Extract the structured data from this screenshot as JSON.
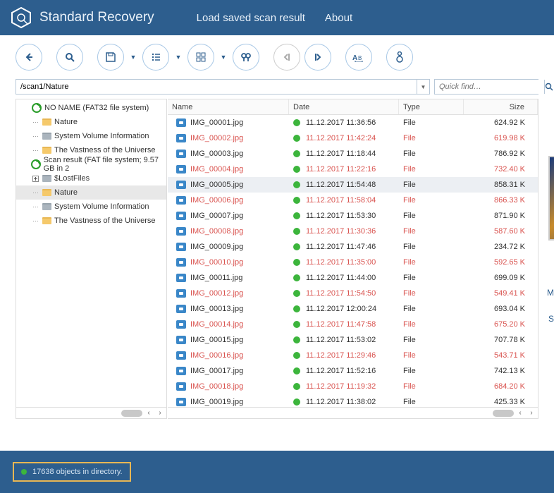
{
  "header": {
    "app_title": "Standard Recovery",
    "nav": {
      "load": "Load saved scan result",
      "about": "About"
    }
  },
  "path": {
    "value": "/scan1/Nature"
  },
  "quick_find": {
    "placeholder": "Quick find…"
  },
  "tree": [
    {
      "indent": 0,
      "exp": "",
      "icon": "disk-green",
      "label": "NO NAME (FAT32 file system)",
      "selected": false
    },
    {
      "indent": 1,
      "exp": "",
      "icon": "folder-yellow",
      "label": "Nature",
      "selected": false,
      "dots": true
    },
    {
      "indent": 1,
      "exp": "",
      "icon": "folder-gray",
      "label": "System Volume Information",
      "selected": false,
      "dots": true
    },
    {
      "indent": 1,
      "exp": "",
      "icon": "folder-yellow",
      "label": "The Vastness of the Universe",
      "selected": false,
      "dots": true
    },
    {
      "indent": 0,
      "exp": "",
      "icon": "disk-green",
      "label": "Scan result (FAT file system; 9.57 GB in 2",
      "selected": false
    },
    {
      "indent": 1,
      "exp": "+",
      "icon": "folder-gray",
      "label": "$LostFiles",
      "selected": false
    },
    {
      "indent": 1,
      "exp": "",
      "icon": "folder-yellow",
      "label": "Nature",
      "selected": true,
      "dots": true
    },
    {
      "indent": 1,
      "exp": "",
      "icon": "folder-gray",
      "label": "System Volume Information",
      "selected": false,
      "dots": true
    },
    {
      "indent": 1,
      "exp": "",
      "icon": "folder-yellow",
      "label": "The Vastness of the Universe",
      "selected": false,
      "dots": true
    }
  ],
  "columns": {
    "name": "Name",
    "date": "Date",
    "type": "Type",
    "size": "Size"
  },
  "files": [
    {
      "name": "IMG_00001.jpg",
      "date": "11.12.2017 11:36:56",
      "type": "File",
      "size": "624.92 K",
      "hl": false,
      "sel": false
    },
    {
      "name": "IMG_00002.jpg",
      "date": "11.12.2017 11:42:24",
      "type": "File",
      "size": "619.98 K",
      "hl": true,
      "sel": false
    },
    {
      "name": "IMG_00003.jpg",
      "date": "11.12.2017 11:18:44",
      "type": "File",
      "size": "786.92 K",
      "hl": false,
      "sel": false
    },
    {
      "name": "IMG_00004.jpg",
      "date": "11.12.2017 11:22:16",
      "type": "File",
      "size": "732.40 K",
      "hl": true,
      "sel": false
    },
    {
      "name": "IMG_00005.jpg",
      "date": "11.12.2017 11:54:48",
      "type": "File",
      "size": "858.31 K",
      "hl": false,
      "sel": true
    },
    {
      "name": "IMG_00006.jpg",
      "date": "11.12.2017 11:58:04",
      "type": "File",
      "size": "866.33 K",
      "hl": true,
      "sel": false
    },
    {
      "name": "IMG_00007.jpg",
      "date": "11.12.2017 11:53:30",
      "type": "File",
      "size": "871.90 K",
      "hl": false,
      "sel": false
    },
    {
      "name": "IMG_00008.jpg",
      "date": "11.12.2017 11:30:36",
      "type": "File",
      "size": "587.60 K",
      "hl": true,
      "sel": false
    },
    {
      "name": "IMG_00009.jpg",
      "date": "11.12.2017 11:47:46",
      "type": "File",
      "size": "234.72 K",
      "hl": false,
      "sel": false
    },
    {
      "name": "IMG_00010.jpg",
      "date": "11.12.2017 11:35:00",
      "type": "File",
      "size": "592.65 K",
      "hl": true,
      "sel": false
    },
    {
      "name": "IMG_00011.jpg",
      "date": "11.12.2017 11:44:00",
      "type": "File",
      "size": "699.09 K",
      "hl": false,
      "sel": false
    },
    {
      "name": "IMG_00012.jpg",
      "date": "11.12.2017 11:54:50",
      "type": "File",
      "size": "549.41 K",
      "hl": true,
      "sel": false
    },
    {
      "name": "IMG_00013.jpg",
      "date": "11.12.2017 12:00:24",
      "type": "File",
      "size": "693.04 K",
      "hl": false,
      "sel": false
    },
    {
      "name": "IMG_00014.jpg",
      "date": "11.12.2017 11:47:58",
      "type": "File",
      "size": "675.20 K",
      "hl": true,
      "sel": false
    },
    {
      "name": "IMG_00015.jpg",
      "date": "11.12.2017 11:53:02",
      "type": "File",
      "size": "707.78 K",
      "hl": false,
      "sel": false
    },
    {
      "name": "IMG_00016.jpg",
      "date": "11.12.2017 11:29:46",
      "type": "File",
      "size": "543.71 K",
      "hl": true,
      "sel": false
    },
    {
      "name": "IMG_00017.jpg",
      "date": "11.12.2017 11:52:16",
      "type": "File",
      "size": "742.13 K",
      "hl": false,
      "sel": false
    },
    {
      "name": "IMG_00018.jpg",
      "date": "11.12.2017 11:19:32",
      "type": "File",
      "size": "684.20 K",
      "hl": true,
      "sel": false
    },
    {
      "name": "IMG_00019.jpg",
      "date": "11.12.2017 11:38:02",
      "type": "File",
      "size": "425.33 K",
      "hl": false,
      "sel": false
    }
  ],
  "side_hints": {
    "m": "M",
    "s": "S"
  },
  "footer": {
    "status": "17638 objects in directory."
  }
}
